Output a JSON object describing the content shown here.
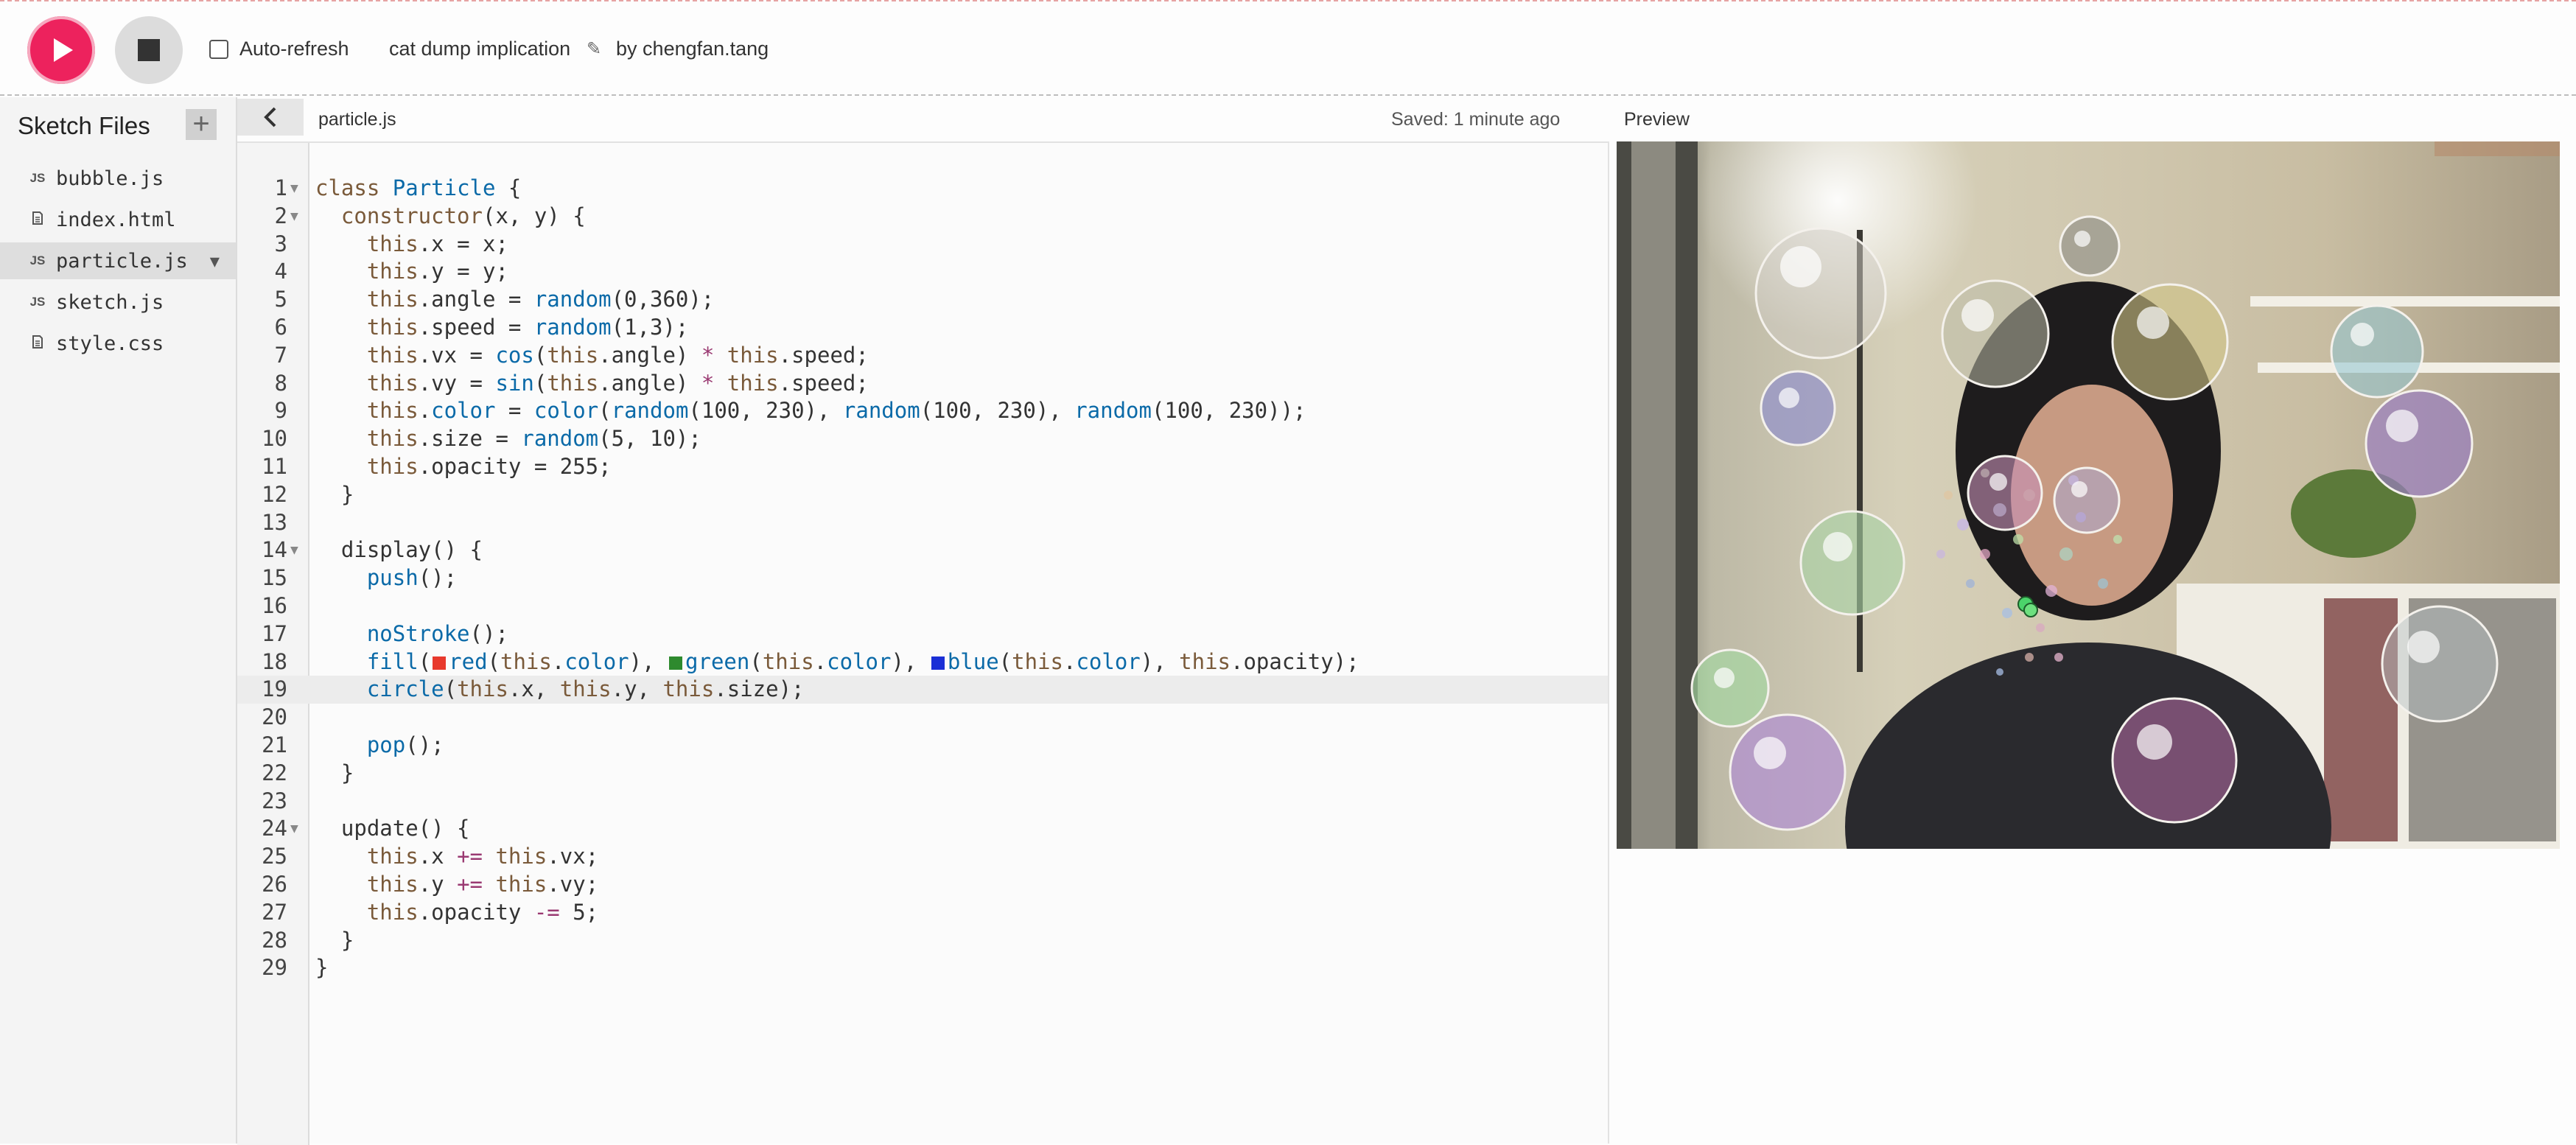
{
  "toolbar": {
    "autorefresh_label": "Auto-refresh",
    "autorefresh_checked": false,
    "sketch_name": "cat dump implication",
    "by_label": "by",
    "author": "chengfan.tang",
    "play_color": "#ed225d"
  },
  "sidebar": {
    "title": "Sketch Files",
    "add_icon": "+",
    "files": [
      {
        "name": "bubble.js",
        "type": "JS",
        "active": false
      },
      {
        "name": "index.html",
        "type": "html",
        "active": false
      },
      {
        "name": "particle.js",
        "type": "JS",
        "active": true
      },
      {
        "name": "sketch.js",
        "type": "JS",
        "active": false
      },
      {
        "name": "style.css",
        "type": "css",
        "active": false
      }
    ]
  },
  "editor": {
    "file_name": "particle.js",
    "saved_status": "Saved: 1 minute ago",
    "current_line": 19,
    "folded_lines": [
      1,
      2,
      14,
      24
    ],
    "lines": [
      "class Particle {",
      "  constructor(x, y) {",
      "    this.x = x;",
      "    this.y = y;",
      "    this.angle = random(0,360);",
      "    this.speed = random(1,3);",
      "    this.vx = cos(this.angle) * this.speed;",
      "    this.vy = sin(this.angle) * this.speed;",
      "    this.color = color(random(100, 230), random(100, 230), random(100, 230));",
      "    this.size = random(5, 10);",
      "    this.opacity = 255;",
      "  }",
      "",
      "  display() {",
      "    push();",
      "",
      "    noStroke();",
      "    fill(red(this.color), green(this.color), blue(this.color), this.opacity);",
      "    circle(this.x, this.y, this.size);",
      "",
      "    pop();",
      "  }",
      "",
      "  update() {",
      "    this.x += this.vx;",
      "    this.y += this.vy;",
      "    this.opacity -= 5;",
      "  }",
      "}"
    ],
    "swatch_colors": {
      "red": "#e8392c",
      "green": "#2e8a2e",
      "blue": "#1a2fd6"
    }
  },
  "preview": {
    "label": "Preview"
  }
}
